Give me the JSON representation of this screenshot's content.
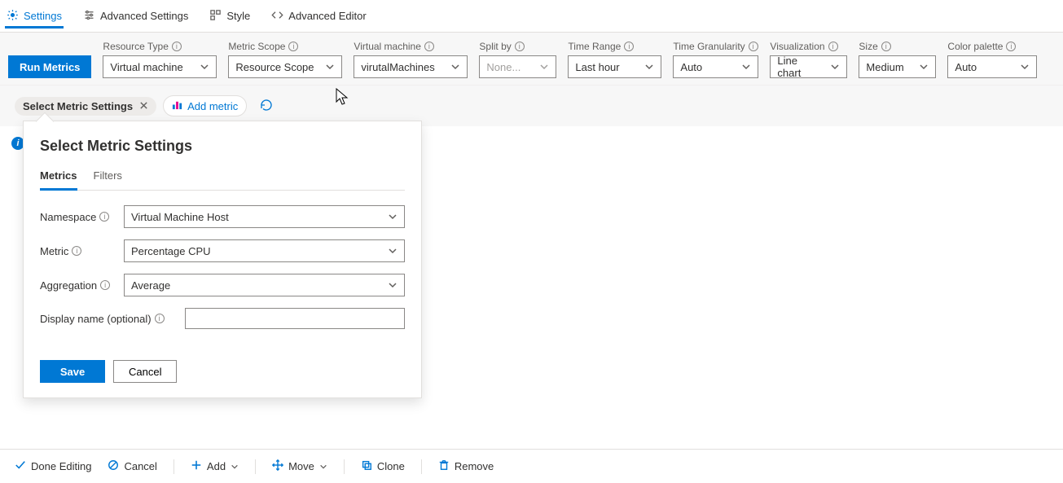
{
  "tabs": {
    "settings": "Settings",
    "advanced_settings": "Advanced Settings",
    "style": "Style",
    "advanced_editor": "Advanced Editor"
  },
  "toolbar": {
    "run_metrics": "Run Metrics",
    "cols": {
      "resource_type": {
        "label": "Resource Type",
        "value": "Virtual machine"
      },
      "metric_scope": {
        "label": "Metric Scope",
        "value": "Resource Scope"
      },
      "virtual_machine": {
        "label": "Virtual machine",
        "value": "virutalMachines"
      },
      "split_by": {
        "label": "Split by",
        "value": "None..."
      },
      "time_range": {
        "label": "Time Range",
        "value": "Last hour"
      },
      "time_gran": {
        "label": "Time Granularity",
        "value": "Auto"
      },
      "visualization": {
        "label": "Visualization",
        "value": "Line chart"
      },
      "size": {
        "label": "Size",
        "value": "Medium"
      },
      "color_palette": {
        "label": "Color palette",
        "value": "Auto"
      }
    }
  },
  "row3": {
    "select_metric_settings": "Select Metric Settings",
    "add_metric": "Add metric"
  },
  "popover": {
    "title": "Select Metric Settings",
    "tabs": {
      "metrics": "Metrics",
      "filters": "Filters"
    },
    "fields": {
      "namespace": {
        "label": "Namespace",
        "value": "Virtual Machine Host"
      },
      "metric": {
        "label": "Metric",
        "value": "Percentage CPU"
      },
      "aggregation": {
        "label": "Aggregation",
        "value": "Average"
      },
      "display_name": {
        "label": "Display name (optional)",
        "value": ""
      }
    },
    "actions": {
      "save": "Save",
      "cancel": "Cancel"
    }
  },
  "footer": {
    "done_editing": "Done Editing",
    "cancel": "Cancel",
    "add": "Add",
    "move": "Move",
    "clone": "Clone",
    "remove": "Remove"
  }
}
